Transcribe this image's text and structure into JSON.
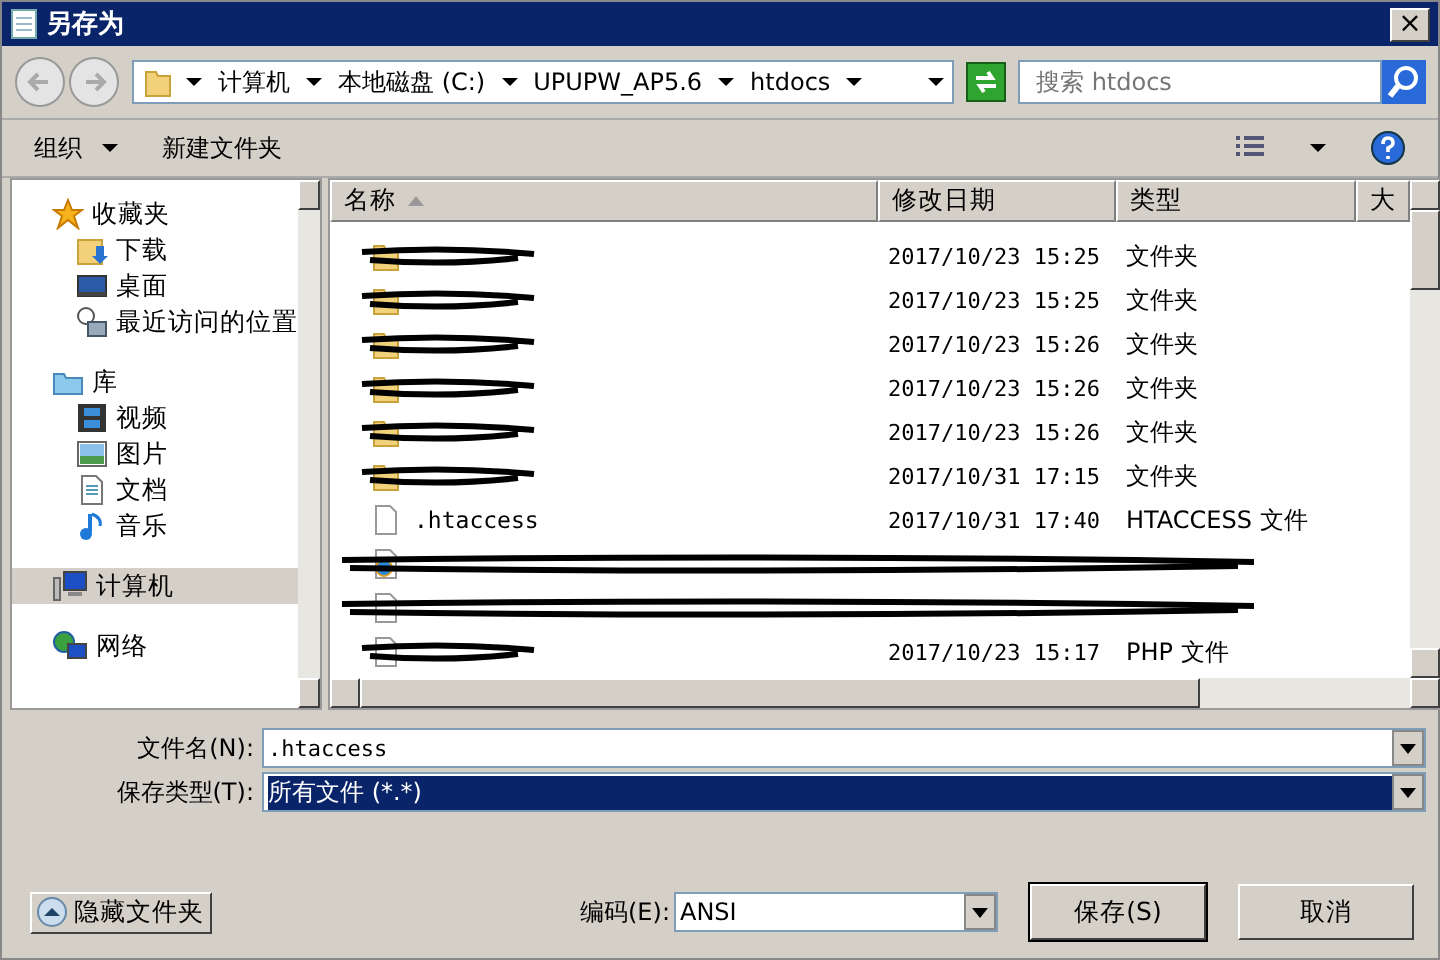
{
  "window": {
    "title": "另存为",
    "close": "×"
  },
  "address": {
    "crumbs": [
      "计算机",
      "本地磁盘 (C:)",
      "UPUPW_AP5.6",
      "htdocs"
    ]
  },
  "search": {
    "placeholder": "搜索 htdocs"
  },
  "toolbar": {
    "organize": "组织",
    "new_folder": "新建文件夹"
  },
  "sidebar": {
    "items": [
      {
        "label": "收藏夹",
        "kind": "favorites",
        "selected": false,
        "children": [
          {
            "label": "下载",
            "kind": "download",
            "selected": false
          },
          {
            "label": "桌面",
            "kind": "desktop",
            "selected": false
          },
          {
            "label": "最近访问的位置",
            "kind": "recent",
            "selected": false
          }
        ]
      },
      {
        "label": "库",
        "kind": "library",
        "selected": false,
        "children": [
          {
            "label": "视频",
            "kind": "video",
            "selected": false
          },
          {
            "label": "图片",
            "kind": "pictures",
            "selected": false
          },
          {
            "label": "文档",
            "kind": "documents",
            "selected": false
          },
          {
            "label": "音乐",
            "kind": "music",
            "selected": false
          }
        ]
      },
      {
        "label": "计算机",
        "kind": "computer",
        "selected": true
      },
      {
        "label": "网络",
        "kind": "network",
        "selected": false
      }
    ]
  },
  "table": {
    "columns": [
      "名称",
      "修改日期",
      "类型",
      "大"
    ],
    "rows": [
      {
        "kind": "folder",
        "date": "2017/10/23 15:25",
        "type": "文件夹",
        "scribbled": true
      },
      {
        "kind": "folder",
        "date": "2017/10/23 15:25",
        "type": "文件夹",
        "scribbled": true
      },
      {
        "kind": "folder",
        "date": "2017/10/23 15:26",
        "type": "文件夹",
        "scribbled": true
      },
      {
        "kind": "folder",
        "date": "2017/10/23 15:26",
        "type": "文件夹",
        "scribbled": true
      },
      {
        "kind": "folder",
        "date": "2017/10/23 15:26",
        "type": "文件夹",
        "scribbled": true
      },
      {
        "kind": "folder",
        "date": "2017/10/31 17:15",
        "type": "文件夹",
        "scribbled": true
      },
      {
        "kind": "file",
        "name": ".htaccess",
        "date": "2017/10/31 17:40",
        "type": "HTACCESS 文件",
        "scribbled": false
      },
      {
        "kind": "web",
        "scribbled": true
      },
      {
        "kind": "file",
        "scribbled": true
      },
      {
        "kind": "file",
        "date": "2017/10/23 15:17",
        "type": "PHP 文件",
        "scribbled": true
      }
    ]
  },
  "form": {
    "filename_label": "文件名(N):",
    "filename": ".htaccess",
    "type_label": "保存类型(T):",
    "type_value": "所有文件 (*.*)",
    "type_selected": true,
    "encoding_label": "编码(E):",
    "encoding": "ANSI"
  },
  "buttons": {
    "hide_folders": "隐藏文件夹",
    "save": "保存(S)",
    "cancel": "取消"
  }
}
